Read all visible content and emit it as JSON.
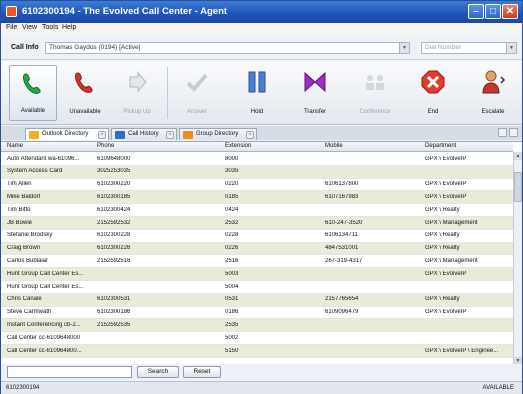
{
  "window": {
    "title": "6102300194 - The Evolved Call Center - Agent"
  },
  "menu": [
    "File",
    "View",
    "Tools",
    "Help"
  ],
  "callinfo": {
    "label": "Call Info",
    "value": "Thomas Gaydos (0194) [Active]",
    "dial_placeholder": "Dial Number"
  },
  "toolbar": [
    {
      "label": "Available",
      "name": "available-button"
    },
    {
      "label": "Unavailable",
      "name": "unavailable-button"
    },
    {
      "label": "Pickup Up",
      "name": "pickup-button"
    },
    {
      "label": "Answer",
      "name": "answer-button"
    },
    {
      "label": "Hold",
      "name": "hold-button"
    },
    {
      "label": "Transfer",
      "name": "transfer-button"
    },
    {
      "label": "Conference",
      "name": "conference-button"
    },
    {
      "label": "End",
      "name": "end-button"
    },
    {
      "label": "Escalate",
      "name": "escalate-button"
    }
  ],
  "tabs": [
    "Outlook Directory",
    "Call History",
    "Group Directory"
  ],
  "columns": [
    "Name",
    "Phone",
    "Extension",
    "Mobile",
    "Department"
  ],
  "rows": [
    [
      "Auto Attendant wa-61096...",
      "6109648000",
      "8000",
      "",
      "GPX \\ EvolveIP"
    ],
    [
      "System Access Card",
      "3025253035",
      "3035",
      "",
      ""
    ],
    [
      "Tim Allen",
      "6102300220",
      "0220",
      "6106137800",
      "GPX \\ EvolveIP"
    ],
    [
      "Mike Baldorf",
      "6102300185",
      "0185",
      "6107167983",
      "GPX \\ EvolveIP"
    ],
    [
      "Tim Bitto",
      "6102300424",
      "0424",
      "",
      "GPX \\ Realty"
    ],
    [
      "JB Bowie",
      "2152592532",
      "2532",
      "610-247-3520",
      "GPX \\ Management"
    ],
    [
      "Stefanie Brodsky",
      "6102300228",
      "0228",
      "6106134711",
      "GPX \\ Realty"
    ],
    [
      "Craig Brown",
      "6102300226",
      "0226",
      "4847531001",
      "GPX \\ Realty"
    ],
    [
      "Carlos Bublaiar",
      "2152592516",
      "2516",
      "267-319-4317",
      "GPX \\ Management"
    ],
    [
      "Hunt Group Call Center Es...",
      "",
      "5003",
      "",
      "GPX \\ EvolveIP"
    ],
    [
      "Hunt Group Call Center Es...",
      "",
      "5004",
      "",
      ""
    ],
    [
      "Chris Canale",
      "6102300531",
      "0531",
      "2157765654",
      "GPX \\ Realty"
    ],
    [
      "Steve Carmwath",
      "6102300186",
      "0186",
      "6109096479",
      "GPX \\ EvolveIP"
    ],
    [
      "Instant Conferencing cb-2...",
      "2152592535",
      "2535",
      "",
      ""
    ],
    [
      "Call Center cc-6109648000",
      "",
      "5002",
      "",
      ""
    ],
    [
      "Call Center cc-610964800...",
      "",
      "5150",
      "",
      "GPX \\ EvolveIP \\ Enginee..."
    ]
  ],
  "search": {
    "button": "Search",
    "reset": "Reset"
  },
  "status": {
    "left": "6102300194",
    "right": "AVAILABLE"
  }
}
